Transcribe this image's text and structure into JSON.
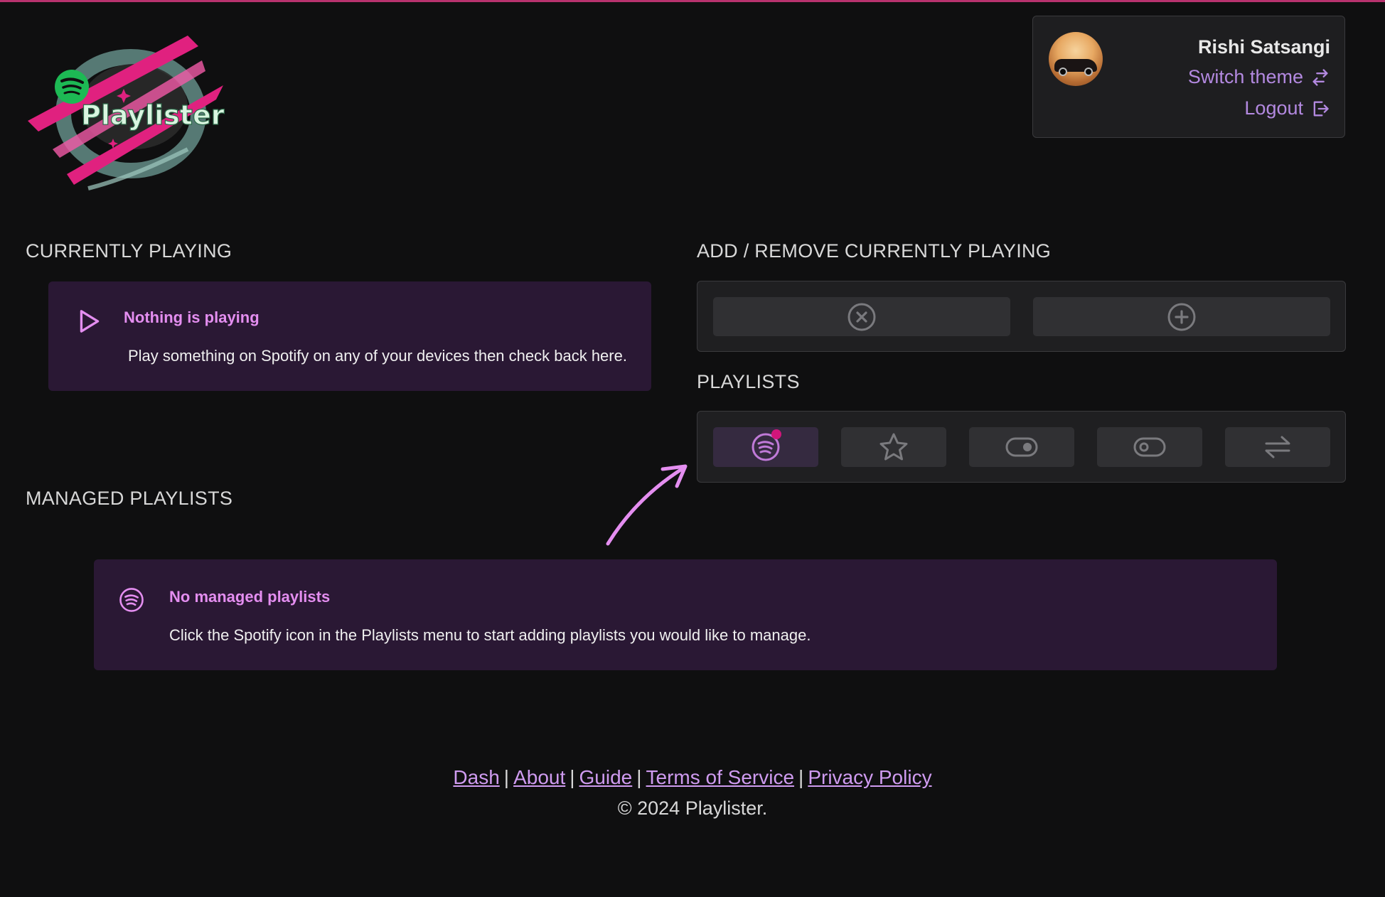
{
  "app": {
    "logo_text": "Playlister",
    "accent": "#e48ef0",
    "brand_pink": "#e0217f"
  },
  "user": {
    "name": "Rishi Satsangi",
    "switch_theme": "Switch theme",
    "logout": "Logout"
  },
  "currently_playing": {
    "heading": "CURRENTLY PLAYING",
    "alert_title": "Nothing is playing",
    "alert_body": "Play something on Spotify on any of your devices then check back here."
  },
  "add_remove": {
    "heading": "ADD / REMOVE CURRENTLY PLAYING",
    "buttons": [
      {
        "icon": "remove-circle-icon"
      },
      {
        "icon": "add-circle-icon"
      }
    ]
  },
  "playlists": {
    "heading": "PLAYLISTS",
    "buttons": [
      {
        "icon": "spotify-icon",
        "active": true,
        "has_notification": true
      },
      {
        "icon": "star-icon"
      },
      {
        "icon": "toggle-on-icon"
      },
      {
        "icon": "toggle-off-icon"
      },
      {
        "icon": "arrows-swap-icon"
      }
    ]
  },
  "managed_playlists": {
    "heading": "MANAGED PLAYLISTS",
    "alert_title": "No managed playlists",
    "alert_body": "Click the Spotify icon in the Playlists menu to start adding playlists you would like to manage."
  },
  "footer": {
    "links": [
      "Dash",
      "About",
      "Guide",
      "Terms of Service",
      "Privacy Policy"
    ],
    "separator": "|",
    "copyright": "© 2024 Playlister."
  }
}
